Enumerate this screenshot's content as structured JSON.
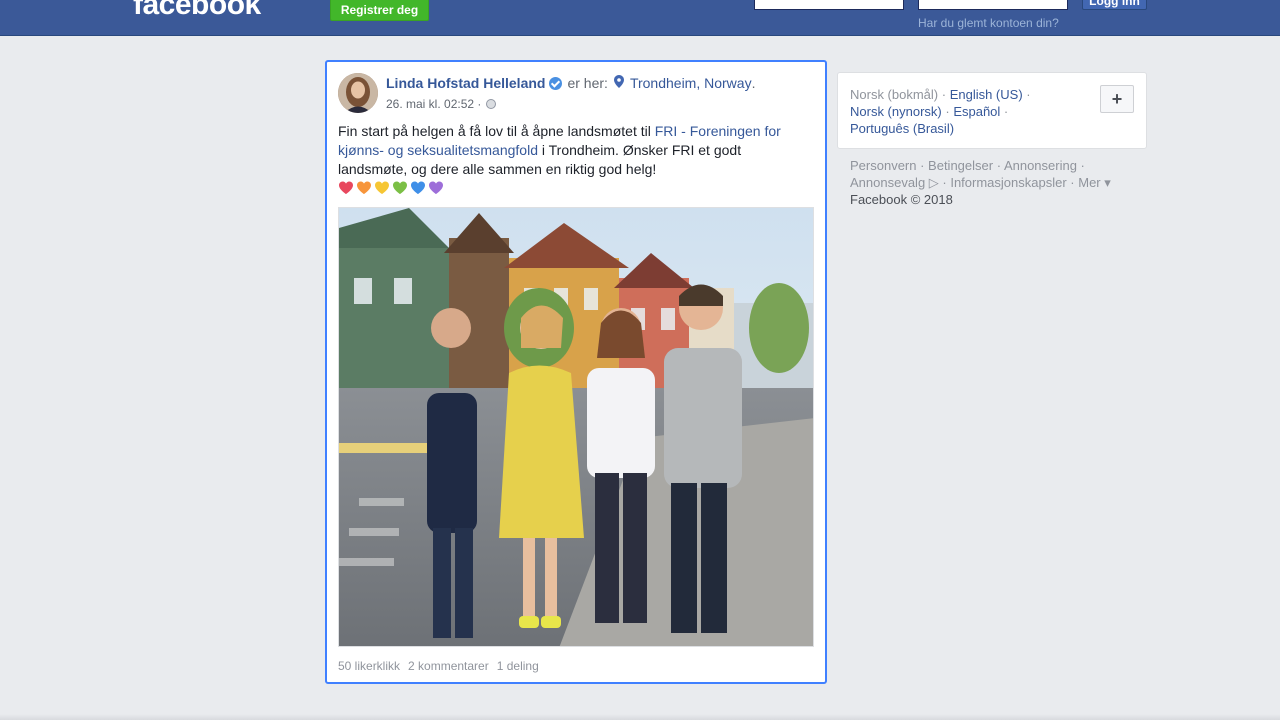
{
  "header": {
    "logo": "facebook",
    "register_label": "Registrer deg",
    "login_label": "Logg inn",
    "forgot_link": "Har du glemt kontoen din?"
  },
  "post": {
    "author": "Linda Hofstad Helleland",
    "presence": "er her:",
    "location": "Trondheim, Norway",
    "timestamp": "26. mai kl. 02:52 ·",
    "text_before": "Fin start på helgen å få lov til å åpne landsmøtet til ",
    "text_link": "FRI - Foreningen for kjønns- og seksualitetsmangfold",
    "text_after": " i Trondheim. Ønsker FRI et godt landsmøte, og dere alle sammen en riktig god helg!",
    "hearts": [
      "#e8475e",
      "#f7953b",
      "#f6c634",
      "#7bbf45",
      "#3f8fe8",
      "#9d6ed9"
    ],
    "likes": "50 likerklikk",
    "comments": "2 kommentarer",
    "shares": "1 deling"
  },
  "languages": {
    "current": "Norsk (bokmål)",
    "english": "English (US)",
    "nynorsk": "Norsk (nynorsk)",
    "spanish": "Español",
    "portuguese": "Português (Brasil)",
    "more_button": "+"
  },
  "footer": {
    "privacy": "Personvern",
    "terms": "Betingelser",
    "advertising": "Annonsering",
    "ad_choices": "Annonsevalg",
    "cookies": "Informasjonskapsler",
    "more": "Mer",
    "copyright": "Facebook © 2018"
  },
  "colors": {
    "brand": "#3b5998",
    "link": "#365899",
    "focus_border": "#4080ff"
  }
}
